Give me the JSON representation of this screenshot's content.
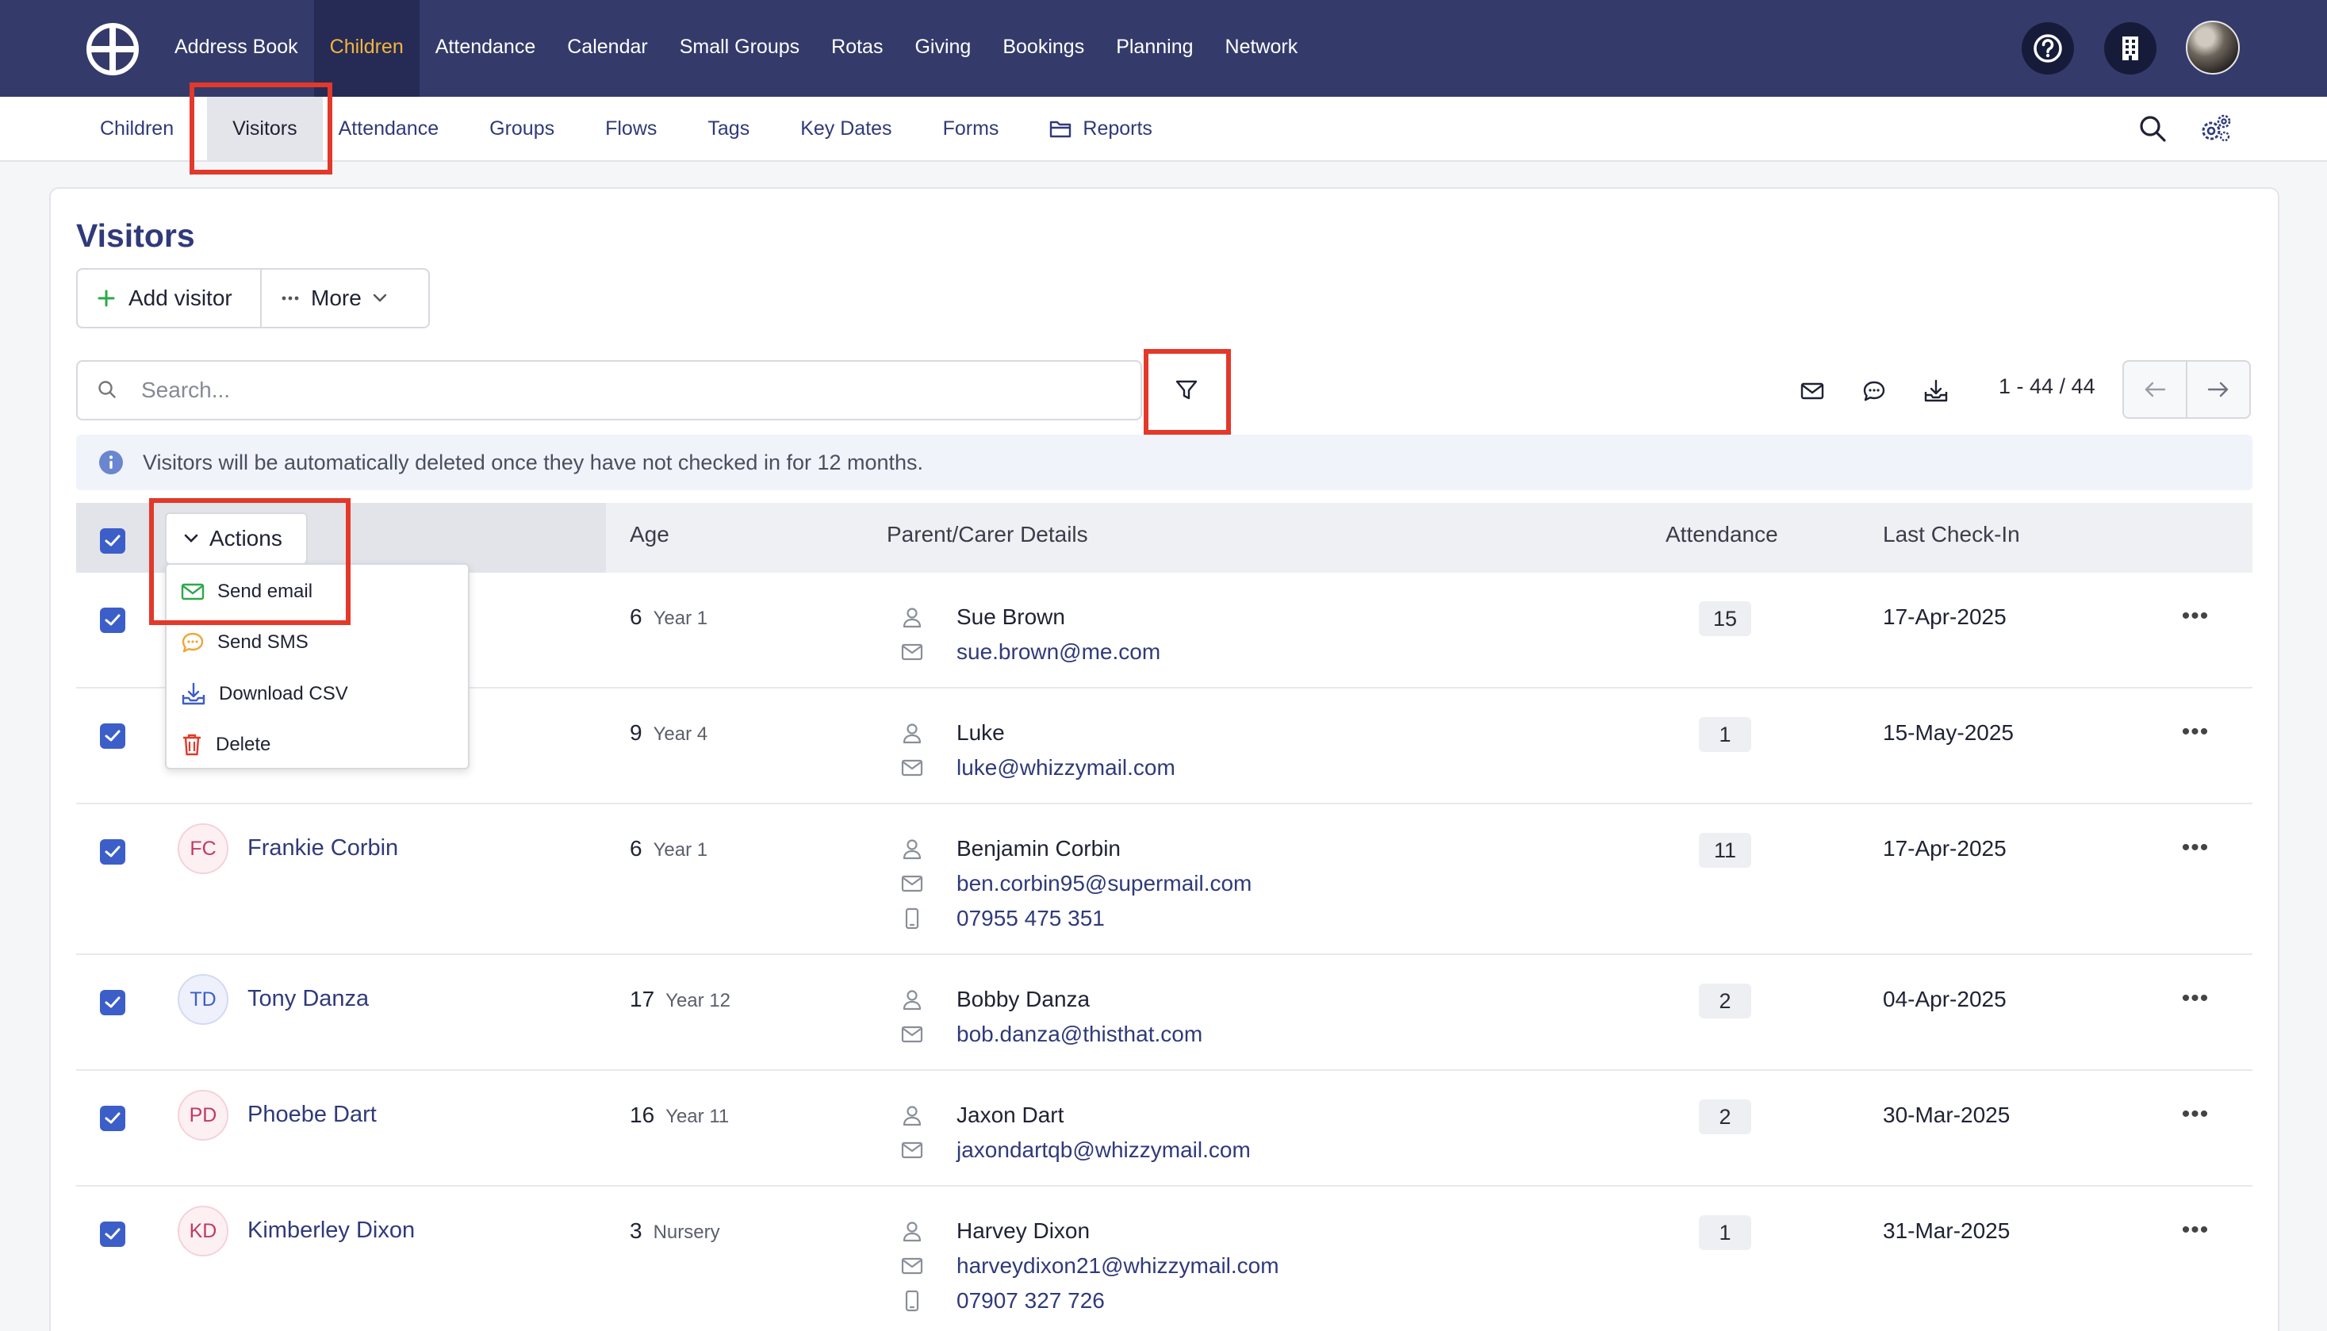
{
  "topnav": {
    "items": [
      "Address Book",
      "Children",
      "Attendance",
      "Calendar",
      "Small Groups",
      "Rotas",
      "Giving",
      "Bookings",
      "Planning",
      "Network"
    ],
    "active_index": 1
  },
  "subnav": {
    "items": [
      "Children",
      "Visitors",
      "Attendance",
      "Groups",
      "Flows",
      "Tags",
      "Key Dates",
      "Forms",
      "Reports"
    ],
    "active_index": 1
  },
  "page": {
    "title": "Visitors",
    "add_label": "Add visitor",
    "more_label": "More",
    "search_placeholder": "Search...",
    "pagination": "1 - 44 / 44",
    "info_text": "Visitors will be automatically deleted once they have not checked in for 12 months."
  },
  "table": {
    "actions_label": "Actions",
    "headers": {
      "age": "Age",
      "parent": "Parent/Carer Details",
      "attendance": "Attendance",
      "last_checkin": "Last Check-In"
    },
    "dropdown": [
      "Send email",
      "Send SMS",
      "Download CSV",
      "Delete"
    ],
    "rows": [
      {
        "initials": "",
        "name": "",
        "age": "6",
        "year": "Year 1",
        "parent": "Sue Brown",
        "email": "sue.brown@me.com",
        "phone": "",
        "attendance": "15",
        "last": "17-Apr-2025"
      },
      {
        "initials": "",
        "name": "",
        "age": "9",
        "year": "Year 4",
        "parent": "Luke",
        "email": "luke@whizzymail.com",
        "phone": "",
        "attendance": "1",
        "last": "15-May-2025"
      },
      {
        "initials": "FC",
        "name": "Frankie Corbin",
        "age": "6",
        "year": "Year 1",
        "parent": "Benjamin Corbin",
        "email": "ben.corbin95@supermail.com",
        "phone": "07955 475 351",
        "attendance": "11",
        "last": "17-Apr-2025"
      },
      {
        "initials": "TD",
        "name": "Tony Danza",
        "age": "17",
        "year": "Year 12",
        "parent": "Bobby Danza",
        "email": "bob.danza@thisthat.com",
        "phone": "",
        "attendance": "2",
        "last": "04-Apr-2025"
      },
      {
        "initials": "PD",
        "name": "Phoebe Dart",
        "age": "16",
        "year": "Year 11",
        "parent": "Jaxon Dart",
        "email": "jaxondartqb@whizzymail.com",
        "phone": "",
        "attendance": "2",
        "last": "30-Mar-2025"
      },
      {
        "initials": "KD",
        "name": "Kimberley Dixon",
        "age": "3",
        "year": "Nursery",
        "parent": "Harvey Dixon",
        "email": "harveydixon21@whizzymail.com",
        "phone": "07907 327 726",
        "attendance": "1",
        "last": "31-Mar-2025"
      }
    ]
  },
  "colors": {
    "nav_bg": "#343b6b",
    "active_nav_text": "#f3b53c",
    "link": "#303a7a",
    "checkbox": "#3c5ec8",
    "highlight": "#e3382a"
  }
}
